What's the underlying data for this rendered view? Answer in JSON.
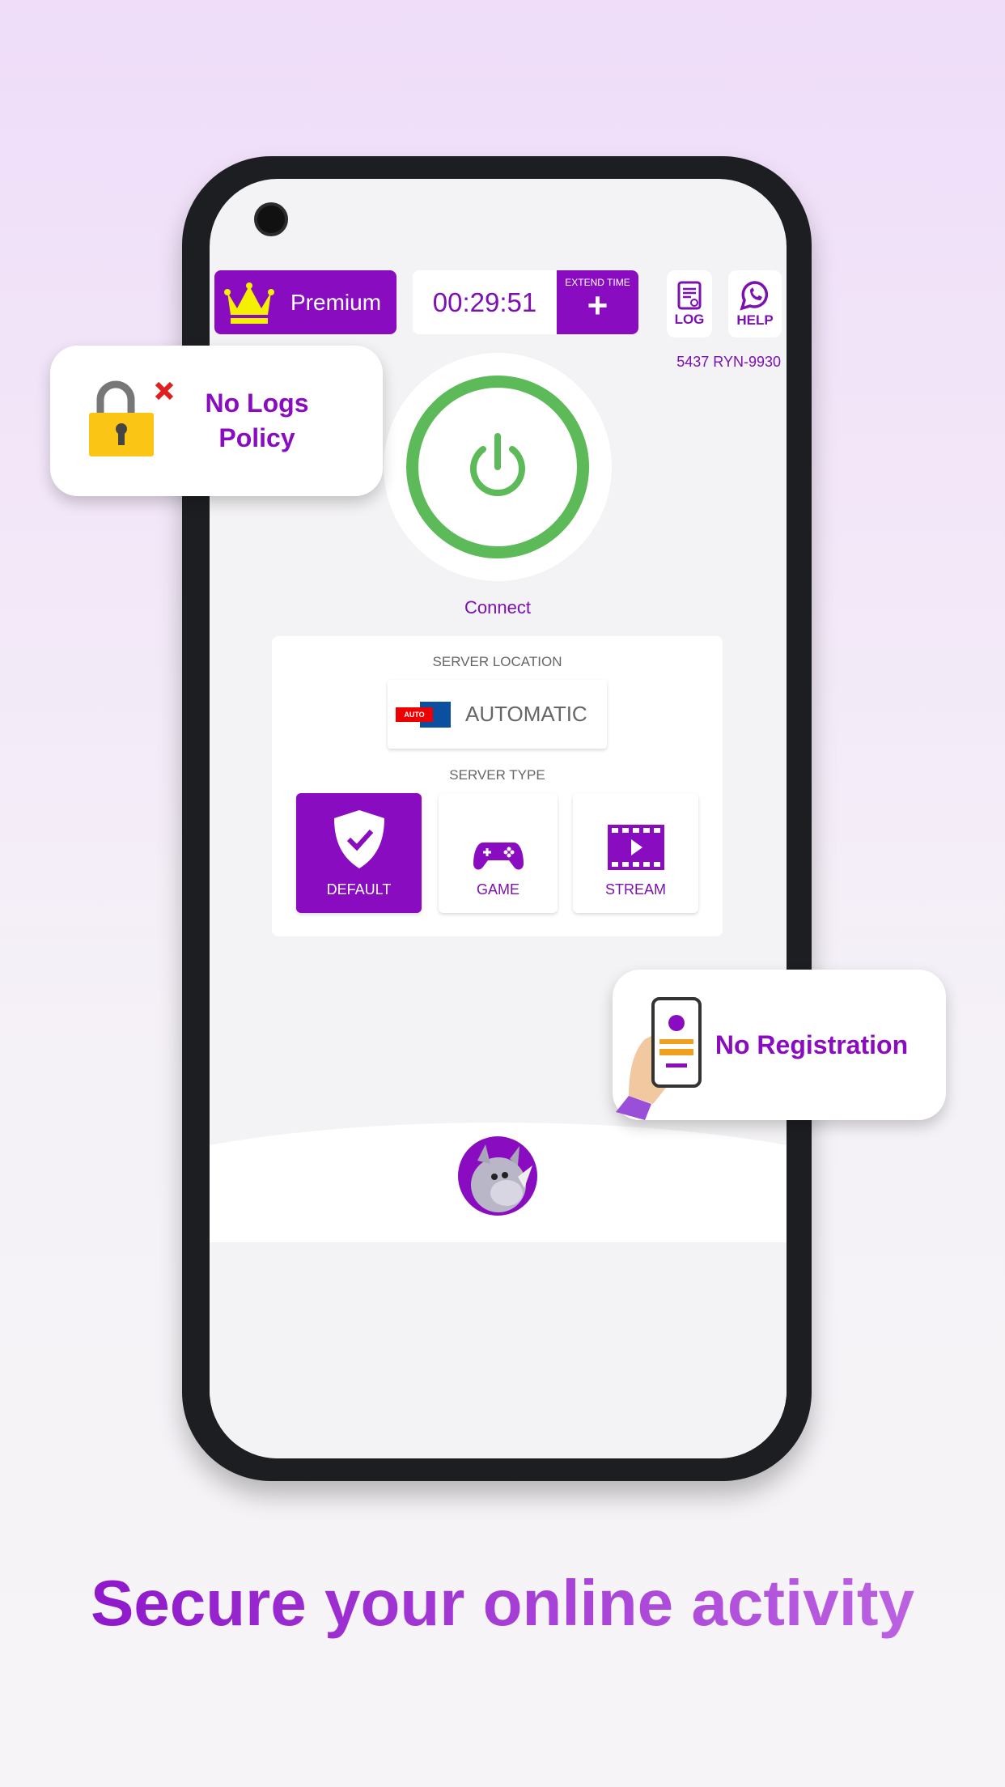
{
  "header": {
    "premium_label": "Premium",
    "timer": "00:29:51",
    "extend_label": "EXTEND TIME",
    "extend_icon": "+",
    "log_label": "LOG",
    "help_label": "HELP",
    "session_id": "5437  RYN-9930"
  },
  "connect": {
    "label": "Connect",
    "ring_color": "#5cba58"
  },
  "server": {
    "location_label": "SERVER LOCATION",
    "auto_badge": "AUTO",
    "location_value": "AUTOMATIC",
    "type_label": "SERVER TYPE",
    "types": [
      {
        "label": "DEFAULT",
        "icon": "shield-check-icon",
        "selected": true
      },
      {
        "label": "GAME",
        "icon": "gamepad-icon",
        "selected": false
      },
      {
        "label": "STREAM",
        "icon": "film-play-icon",
        "selected": false
      }
    ]
  },
  "features": {
    "no_logs": "No Logs Policy",
    "no_registration": "No Registration"
  },
  "tagline": "Secure your online activity",
  "colors": {
    "accent": "#8a0cc0",
    "text_purple": "#7c10b0",
    "green": "#5cba58"
  }
}
